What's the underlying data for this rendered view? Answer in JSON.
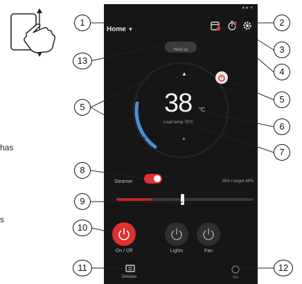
{
  "header": {
    "location": "Home",
    "chevron": "▾"
  },
  "status_indicators": "■ ■ ▼",
  "mode_pill": "Heat up",
  "thermostat": {
    "temperature": "38",
    "unit": "°C",
    "subtext": "Lead temp 78°C",
    "increase_glyph": "▲",
    "decrease_glyph": "+"
  },
  "steamer": {
    "label": "Steamer",
    "on": true,
    "info": "28% / target 48%"
  },
  "slider": {
    "level": 0.47
  },
  "controls": [
    {
      "label": "On / Off",
      "active": true
    },
    {
      "label": "Lights",
      "active": false
    },
    {
      "label": "Fan",
      "active": false
    }
  ],
  "bottom_nav": {
    "left_label": "Devices",
    "right_label": "Me"
  },
  "side_text": {
    "top": "has",
    "bottom": "s"
  },
  "callouts": [
    "1",
    "2",
    "3",
    "4",
    "5",
    "5",
    "6",
    "7",
    "8",
    "9",
    "10",
    "11",
    "12",
    "13"
  ],
  "colors": {
    "accent": "#e23030",
    "ring": "#4a8fd6",
    "background": "#161616"
  },
  "icons": [
    "swipe-hand-icon",
    "calendar-icon",
    "timer-icon",
    "gear-icon",
    "power-icon",
    "chip-icon",
    "help-icon",
    "clock-badge-icon"
  ]
}
